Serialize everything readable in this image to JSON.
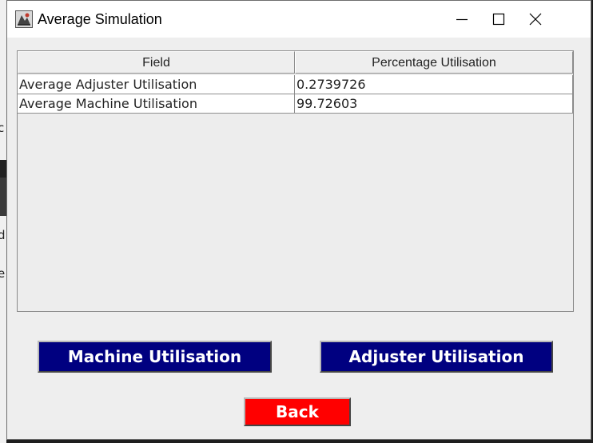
{
  "background_app": {
    "letters": [
      "c",
      "d",
      "e"
    ]
  },
  "window": {
    "title": "Average Simulation",
    "controls": {
      "minimize": "minimize-icon",
      "maximize": "maximize-icon",
      "close": "close-icon"
    }
  },
  "table": {
    "headers": [
      "Field",
      "Percentage Utilisation"
    ],
    "rows": [
      [
        "Average Adjuster Utilisation",
        "0.2739726"
      ],
      [
        "Average Machine Utilisation",
        "99.72603"
      ]
    ]
  },
  "buttons": {
    "machine": "Machine Utilisation",
    "adjuster": "Adjuster Utilisation",
    "back": "Back"
  },
  "colors": {
    "primary_button": "#000080",
    "back_button": "#ff0000",
    "window_bg": "#eeeeee"
  }
}
